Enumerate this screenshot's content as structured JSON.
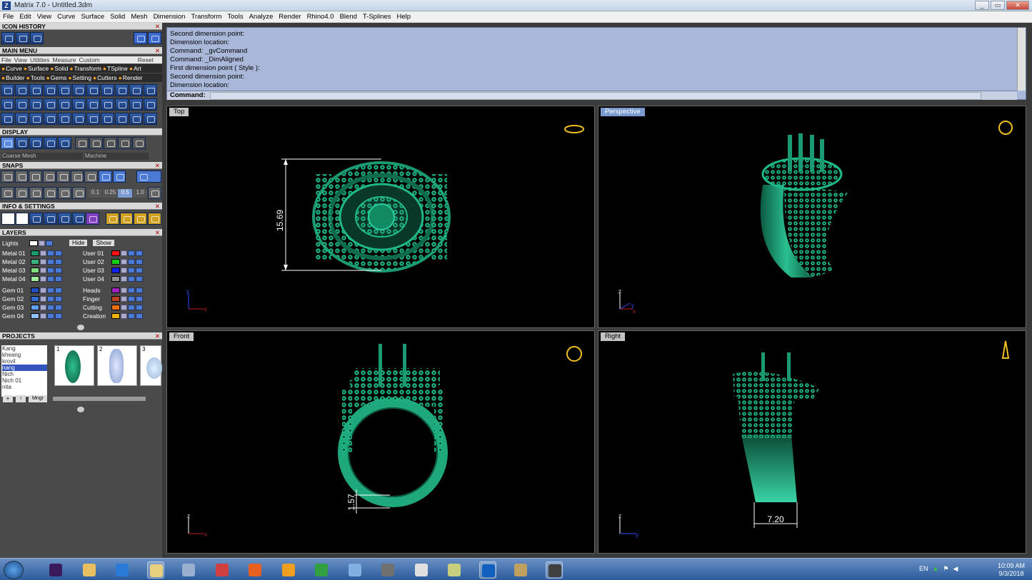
{
  "window": {
    "title": "Matrix 7.0 - Untitled.3dm",
    "app_icon": "Z",
    "min": "_",
    "max": "▭",
    "close": "✕"
  },
  "menu": [
    "File",
    "Edit",
    "View",
    "Curve",
    "Surface",
    "Solid",
    "Mesh",
    "Dimension",
    "Transform",
    "Tools",
    "Analyze",
    "Render",
    "Rhino4.0",
    "Blend",
    "T-Splines",
    "Help"
  ],
  "left": {
    "icon_history": "ICON HISTORY",
    "main_menu": "MAIN MENU",
    "submenu": [
      "File",
      "View",
      "Utilities",
      "Measure",
      "Custom"
    ],
    "reset": "Reset",
    "cat_row1": [
      "Curve",
      "Surface",
      "Solid",
      "Transform",
      "TSpline",
      "Art"
    ],
    "cat_row2": [
      "Builder",
      "Tools",
      "Gems",
      "Setting",
      "Cutters",
      "Render"
    ],
    "display": "DISPLAY",
    "display_mode1": "Coarse Mesh",
    "display_mode2": "Machine",
    "snaps": "SNAPS",
    "snap_vals": [
      "0.1",
      "0.25",
      "0.5",
      "1.0"
    ],
    "info": "INFO & SETTINGS",
    "layers": "LAYERS",
    "lights": "Lights",
    "hide": "Hide",
    "show": "Show",
    "layers_left": [
      {
        "name": "Metal 01",
        "color": "#1a9a6a"
      },
      {
        "name": "Metal 02",
        "color": "#3ab07a"
      },
      {
        "name": "Metal 03",
        "color": "#80e080"
      },
      {
        "name": "Metal 04",
        "color": "#a0f0a0"
      },
      {
        "name": "Gem 01",
        "color": "#2050c0"
      },
      {
        "name": "Gem 02",
        "color": "#3070d0"
      },
      {
        "name": "Gem 03",
        "color": "#60a0f0"
      },
      {
        "name": "Gem 04",
        "color": "#90c0ff"
      }
    ],
    "layers_right": [
      {
        "name": "User 01",
        "color": "#ff1010"
      },
      {
        "name": "User 02",
        "color": "#10d010"
      },
      {
        "name": "User 03",
        "color": "#1020ff"
      },
      {
        "name": "User 04",
        "color": "#909090"
      },
      {
        "name": "Heads",
        "color": "#a020c0"
      },
      {
        "name": "Finger",
        "color": "#c04020"
      },
      {
        "name": "Cutting",
        "color": "#f07010"
      },
      {
        "name": "Creation",
        "color": "#f0b000"
      }
    ],
    "projects": "PROJECTS",
    "project_list": [
      "Kang",
      "kheang",
      "krovil",
      "nang",
      "Nich",
      "Nich 01",
      "nita"
    ],
    "project_selected": "nang",
    "thumbs": [
      "1",
      "2",
      "3"
    ],
    "mngr": "Mngr"
  },
  "command": {
    "history": [
      "Second dimension point:",
      "Dimension location:",
      "Command: _gvCommand",
      "Command: _DimAligned",
      "First dimension point ( Style ):",
      "Second dimension point:",
      "Dimension location:"
    ],
    "prompt": "Command:"
  },
  "viewports": [
    {
      "name": "Top",
      "dimension": "15.69",
      "axes": [
        "y",
        "x"
      ]
    },
    {
      "name": "Perspective",
      "axes": [
        "z",
        "y",
        "x"
      ]
    },
    {
      "name": "Front",
      "dimension": "1.57",
      "axes": [
        "z",
        "x"
      ]
    },
    {
      "name": "Right",
      "dimension": "7.20",
      "axes": [
        "z",
        "y"
      ]
    }
  ],
  "taskbar": {
    "lang": "EN",
    "time": "10:09 AM",
    "date": "9/3/2018",
    "apps": [
      "premiere-icon",
      "folder-icon",
      "ie-icon",
      "explorer-icon",
      "calculator-icon",
      "snipping-icon",
      "firefox-icon",
      "media-icon",
      "chrome-icon",
      "eraser-icon",
      "pen-icon",
      "zbrush-icon",
      "notes-icon",
      "matrix-icon",
      "paint-icon",
      "clipboard-icon"
    ]
  },
  "colors": {
    "ring": "#1a9a72",
    "ring_dark": "#0b5a40",
    "cmd_bg": "#a9b8d8",
    "gold": "#f0c020"
  }
}
